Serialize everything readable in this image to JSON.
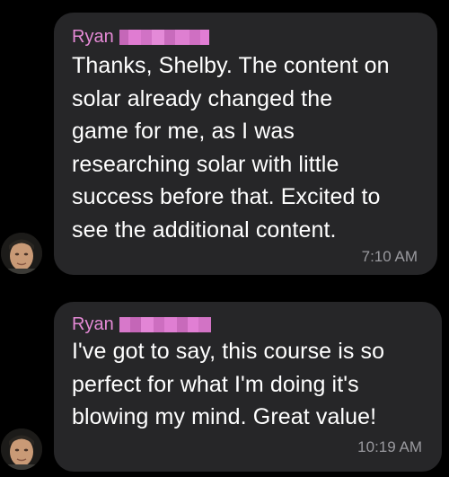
{
  "messages": [
    {
      "sender": "Ryan",
      "text": "Thanks, Shelby. The content on\nsolar already changed the\ngame for me, as I was\nresearching solar with little\nsuccess before that. Excited to\nsee the additional content.",
      "time": "7:10 AM"
    },
    {
      "sender": "Ryan",
      "text": "I've got to say, this course is so\nperfect for what I'm doing it's\nblowing my mind. Great value!",
      "time": "10:19 AM"
    }
  ],
  "colors": {
    "background": "#000000",
    "bubble": "#262628",
    "sender_name": "#e58ad6",
    "timestamp": "#9a9a9f",
    "redaction": "#e07cd2"
  },
  "icons": {
    "avatar": "user-photo-avatar",
    "redaction": "pixelated-last-name"
  }
}
